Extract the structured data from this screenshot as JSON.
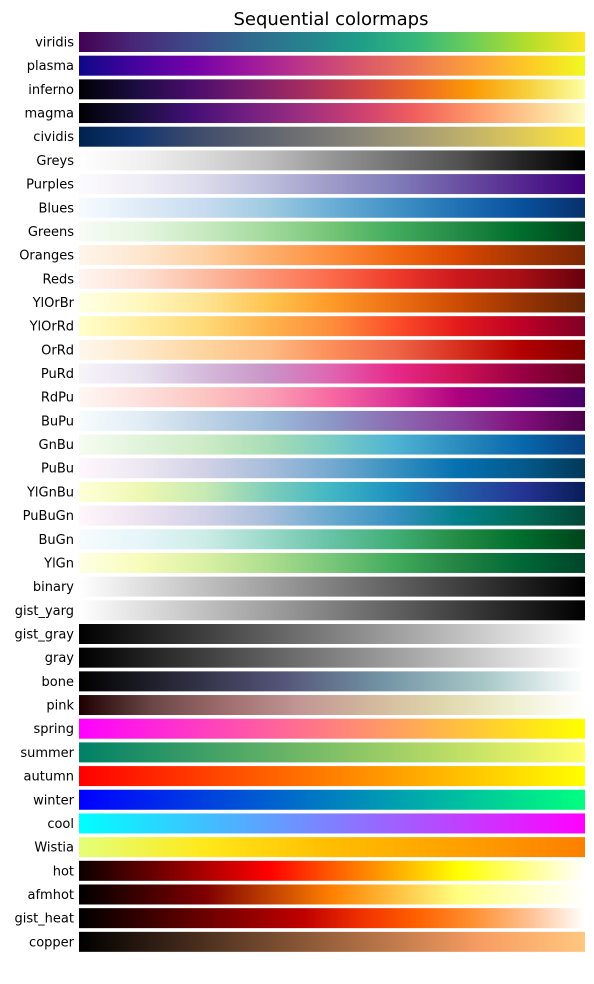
{
  "chart_data": {
    "type": "heatmap",
    "title": "Sequential colormaps",
    "xlabel": "",
    "ylabel": "",
    "grid": false,
    "description": "Each row is a horizontal gradient spanning the colormap from 0 (left) to 1 (right).",
    "colormaps": [
      {
        "name": "viridis",
        "stops": [
          "#440154",
          "#482878",
          "#3e4989",
          "#31688e",
          "#26828e",
          "#1f9e89",
          "#35b779",
          "#6ece58",
          "#b5de2b",
          "#fde725"
        ]
      },
      {
        "name": "plasma",
        "stops": [
          "#0d0887",
          "#46039f",
          "#7201a8",
          "#9c179e",
          "#bd3786",
          "#d8576b",
          "#ed7953",
          "#fb9f3a",
          "#fdca26",
          "#f0f921"
        ]
      },
      {
        "name": "inferno",
        "stops": [
          "#000004",
          "#1b0c41",
          "#4a0c6b",
          "#781c6d",
          "#a52c60",
          "#cf4446",
          "#ed6925",
          "#fb9b06",
          "#f7d13d",
          "#fcffa4"
        ]
      },
      {
        "name": "magma",
        "stops": [
          "#000004",
          "#180f3d",
          "#440f76",
          "#721f81",
          "#9e2f7f",
          "#cd4071",
          "#f1605d",
          "#fd9668",
          "#feca8d",
          "#fcfdbf"
        ]
      },
      {
        "name": "cividis",
        "stops": [
          "#00224e",
          "#123570",
          "#3b496c",
          "#575d6d",
          "#707173",
          "#8a8678",
          "#a59c74",
          "#c3b369",
          "#e1cc55",
          "#fee838"
        ]
      },
      {
        "name": "Greys",
        "stops": [
          "#ffffff",
          "#f0f0f0",
          "#d9d9d9",
          "#bdbdbd",
          "#969696",
          "#737373",
          "#525252",
          "#252525",
          "#000000"
        ]
      },
      {
        "name": "Purples",
        "stops": [
          "#fcfbfd",
          "#efedf5",
          "#dadaeb",
          "#bcbddc",
          "#9e9ac8",
          "#807dba",
          "#6a51a3",
          "#54278f",
          "#3f007d"
        ]
      },
      {
        "name": "Blues",
        "stops": [
          "#f7fbff",
          "#deebf7",
          "#c6dbef",
          "#9ecae1",
          "#6baed6",
          "#4292c6",
          "#2171b5",
          "#08519c",
          "#08306b"
        ]
      },
      {
        "name": "Greens",
        "stops": [
          "#f7fcf5",
          "#e5f5e0",
          "#c7e9c0",
          "#a1d99b",
          "#74c476",
          "#41ab5d",
          "#238b45",
          "#006d2c",
          "#00441b"
        ]
      },
      {
        "name": "Oranges",
        "stops": [
          "#fff5eb",
          "#fee6ce",
          "#fdd0a2",
          "#fdae6b",
          "#fd8d3c",
          "#f16913",
          "#d94801",
          "#a63603",
          "#7f2704"
        ]
      },
      {
        "name": "Reds",
        "stops": [
          "#fff5f0",
          "#fee0d2",
          "#fcbba1",
          "#fc9272",
          "#fb6a4a",
          "#ef3b2c",
          "#cb181d",
          "#a50f15",
          "#67000d"
        ]
      },
      {
        "name": "YlOrBr",
        "stops": [
          "#ffffe5",
          "#fff7bc",
          "#fee391",
          "#fec44f",
          "#fe9929",
          "#ec7014",
          "#cc4c02",
          "#993404",
          "#662506"
        ]
      },
      {
        "name": "YlOrRd",
        "stops": [
          "#ffffcc",
          "#ffeda0",
          "#fed976",
          "#feb24c",
          "#fd8d3c",
          "#fc4e2a",
          "#e31a1c",
          "#bd0026",
          "#800026"
        ]
      },
      {
        "name": "OrRd",
        "stops": [
          "#fff7ec",
          "#fee8c8",
          "#fdd49e",
          "#fdbb84",
          "#fc8d59",
          "#ef6548",
          "#d7301f",
          "#b30000",
          "#7f0000"
        ]
      },
      {
        "name": "PuRd",
        "stops": [
          "#f7f4f9",
          "#e7e1ef",
          "#d4b9da",
          "#c994c7",
          "#df65b0",
          "#e7298a",
          "#ce1256",
          "#980043",
          "#67001f"
        ]
      },
      {
        "name": "RdPu",
        "stops": [
          "#fff7f3",
          "#fde0dd",
          "#fcc5c0",
          "#fa9fb5",
          "#f768a1",
          "#dd3497",
          "#ae017e",
          "#7a0177",
          "#49006a"
        ]
      },
      {
        "name": "BuPu",
        "stops": [
          "#f7fcfd",
          "#e0ecf4",
          "#bfd3e6",
          "#9ebcda",
          "#8c96c6",
          "#8c6bb1",
          "#88419d",
          "#810f7c",
          "#4d004b"
        ]
      },
      {
        "name": "GnBu",
        "stops": [
          "#f7fcf0",
          "#e0f3db",
          "#ccebc5",
          "#a8ddb5",
          "#7bccc4",
          "#4eb3d3",
          "#2b8cbe",
          "#0868ac",
          "#084081"
        ]
      },
      {
        "name": "PuBu",
        "stops": [
          "#fff7fb",
          "#ece7f2",
          "#d0d1e6",
          "#a6bddb",
          "#74a9cf",
          "#3690c0",
          "#0570b0",
          "#045a8d",
          "#023858"
        ]
      },
      {
        "name": "YlGnBu",
        "stops": [
          "#ffffd9",
          "#edf8b1",
          "#c7e9b4",
          "#7fcdbb",
          "#41b6c4",
          "#1d91c0",
          "#225ea8",
          "#253494",
          "#081d58"
        ]
      },
      {
        "name": "PuBuGn",
        "stops": [
          "#fff7fb",
          "#ece2f0",
          "#d0d1e6",
          "#a6bddb",
          "#67a9cf",
          "#3690c0",
          "#02818a",
          "#016c59",
          "#014636"
        ]
      },
      {
        "name": "BuGn",
        "stops": [
          "#f7fcfd",
          "#e5f5f9",
          "#ccece6",
          "#99d8c9",
          "#66c2a4",
          "#41ae76",
          "#238b45",
          "#006d2c",
          "#00441b"
        ]
      },
      {
        "name": "YlGn",
        "stops": [
          "#ffffe5",
          "#f7fcb9",
          "#d9f0a3",
          "#addd8e",
          "#78c679",
          "#41ab5d",
          "#238443",
          "#006837",
          "#004529"
        ]
      },
      {
        "name": "binary",
        "stops": [
          "#ffffff",
          "#000000"
        ]
      },
      {
        "name": "gist_yarg",
        "stops": [
          "#ffffff",
          "#000000"
        ]
      },
      {
        "name": "gist_gray",
        "stops": [
          "#000000",
          "#ffffff"
        ]
      },
      {
        "name": "gray",
        "stops": [
          "#000000",
          "#ffffff"
        ]
      },
      {
        "name": "bone",
        "stops": [
          "#000000",
          "#2b2b3c",
          "#545478",
          "#7394a5",
          "#a7c7c7",
          "#ffffff"
        ]
      },
      {
        "name": "pink",
        "stops": [
          "#1e0000",
          "#6a4646",
          "#9e6c6c",
          "#c09494",
          "#d2b79c",
          "#dfd6ac",
          "#efefd0",
          "#ffffff"
        ]
      },
      {
        "name": "spring",
        "stops": [
          "#ff00ff",
          "#ffff00"
        ]
      },
      {
        "name": "summer",
        "stops": [
          "#008066",
          "#ffff66"
        ]
      },
      {
        "name": "autumn",
        "stops": [
          "#ff0000",
          "#ffff00"
        ]
      },
      {
        "name": "winter",
        "stops": [
          "#0000ff",
          "#00ff80"
        ]
      },
      {
        "name": "cool",
        "stops": [
          "#00ffff",
          "#ff00ff"
        ]
      },
      {
        "name": "Wistia",
        "stops": [
          "#e4ff7a",
          "#ffe81a",
          "#ffbd00",
          "#ffa000",
          "#fc7f00"
        ]
      },
      {
        "name": "hot",
        "stops": [
          "#0b0000",
          "#5b0000",
          "#ad0000",
          "#ff0000",
          "#ff5a00",
          "#ffac00",
          "#ffff00",
          "#ffff80",
          "#ffffff"
        ]
      },
      {
        "name": "afmhot",
        "stops": [
          "#000000",
          "#400000",
          "#800000",
          "#c04000",
          "#ff8000",
          "#ffc040",
          "#ffff80",
          "#ffffc0",
          "#ffffff"
        ]
      },
      {
        "name": "gist_heat",
        "stops": [
          "#000000",
          "#300000",
          "#600000",
          "#900000",
          "#c00000",
          "#f03000",
          "#ff6000",
          "#ff9030",
          "#ffc090",
          "#ffffff"
        ]
      },
      {
        "name": "copper",
        "stops": [
          "#000000",
          "#3e2719",
          "#7c4f31",
          "#ba7649",
          "#f89e63",
          "#ffc77f"
        ]
      }
    ]
  }
}
